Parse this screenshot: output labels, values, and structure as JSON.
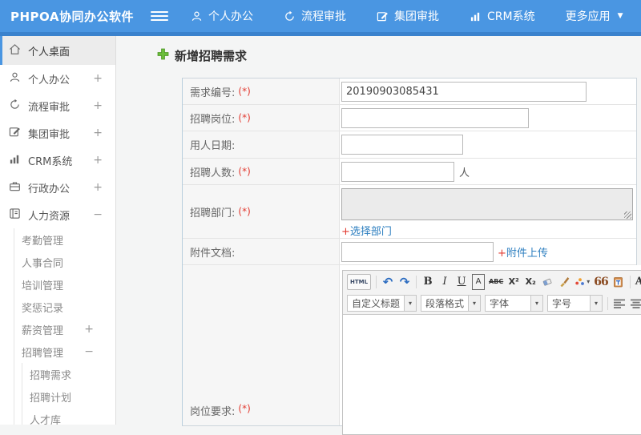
{
  "topbar": {
    "logo": "PHPOA协同办公软件",
    "nav": [
      {
        "label": "个人办公",
        "icon": "user-icon"
      },
      {
        "label": "流程审批",
        "icon": "process-icon"
      },
      {
        "label": "集团审批",
        "icon": "edit-icon"
      },
      {
        "label": "CRM系统",
        "icon": "chart-icon"
      },
      {
        "label": "更多应用",
        "icon": "caret-down-icon"
      }
    ]
  },
  "sidebar": {
    "items": [
      {
        "label": "个人桌面",
        "icon": "home-icon",
        "active": true
      },
      {
        "label": "个人办公",
        "icon": "user-icon",
        "expander": "+"
      },
      {
        "label": "流程审批",
        "icon": "process-icon",
        "expander": "+"
      },
      {
        "label": "集团审批",
        "icon": "edit-icon",
        "expander": "+"
      },
      {
        "label": "CRM系统",
        "icon": "chart-icon",
        "expander": "+"
      },
      {
        "label": "行政办公",
        "icon": "briefcase-icon",
        "expander": "+"
      },
      {
        "label": "人力资源",
        "icon": "hr-icon",
        "expander": "−"
      }
    ],
    "hr_children": [
      {
        "label": "考勤管理"
      },
      {
        "label": "人事合同"
      },
      {
        "label": "培训管理"
      },
      {
        "label": "奖惩记录"
      },
      {
        "label": "薪资管理",
        "expander": "+"
      },
      {
        "label": "招聘管理",
        "expander": "−"
      }
    ],
    "recruit_children": [
      {
        "label": "招聘需求"
      },
      {
        "label": "招聘计划"
      },
      {
        "label": "人才库"
      }
    ]
  },
  "main": {
    "page_title": "新增招聘需求",
    "form": {
      "rows": [
        {
          "label": "需求编号:",
          "req": "(*)",
          "value": "20190903085431"
        },
        {
          "label": "招聘岗位:",
          "req": "(*)",
          "value": ""
        },
        {
          "label": "用人日期:",
          "value": ""
        },
        {
          "label": "招聘人数:",
          "req": "(*)",
          "value": "",
          "suffix": "人"
        },
        {
          "label": "招聘部门:",
          "req": "(*)",
          "link_plus": "+",
          "link_text": "选择部门"
        },
        {
          "label": "附件文档:",
          "value": "",
          "link_plus": "+",
          "link_text": "附件上传"
        },
        {
          "label": "岗位要求:",
          "req": "(*)"
        }
      ]
    },
    "editor": {
      "glyphs": {
        "source": "HTML",
        "undo": "↶",
        "redo": "↷",
        "bold": "B",
        "italic": "I",
        "underline": "U",
        "box_a": "A",
        "strike": "ABC",
        "sup": "X²",
        "sub": "X₂",
        "quote": "66",
        "fontcolor": "A",
        "highlight": "ab",
        "caret": "▾"
      },
      "dropdowns": [
        {
          "label": "自定义标题"
        },
        {
          "label": "段落格式"
        },
        {
          "label": "字体"
        },
        {
          "label": "字号"
        }
      ]
    }
  },
  "colors": {
    "topbar_blue": "#4a96e2",
    "topbar_blue_dark": "#3a82cd",
    "accent_blue": "#4a96e2",
    "link_blue": "#2e7fc0",
    "required_red": "#e23a30",
    "title_plus_green": "#6cbf3c"
  }
}
